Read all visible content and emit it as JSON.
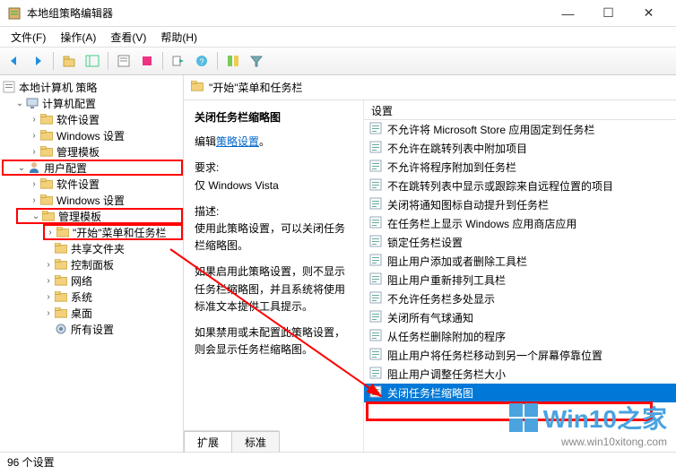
{
  "window": {
    "title": "本地组策略编辑器",
    "min": "—",
    "max": "☐",
    "close": "✕"
  },
  "menus": {
    "file": "文件(F)",
    "action": "操作(A)",
    "view": "查看(V)",
    "help": "帮助(H)"
  },
  "tree": {
    "root": "本地计算机 策略",
    "computer": "计算机配置",
    "c_software": "软件设置",
    "c_windows": "Windows 设置",
    "c_admin": "管理模板",
    "user": "用户配置",
    "u_software": "软件设置",
    "u_windows": "Windows 设置",
    "u_admin": "管理模板",
    "start_taskbar": "\"开始\"菜单和任务栏",
    "shared": "共享文件夹",
    "control": "控制面板",
    "network": "网络",
    "system": "系统",
    "desktop": "桌面",
    "all": "所有设置"
  },
  "pathbar": {
    "label": "\"开始\"菜单和任务栏"
  },
  "desc": {
    "title": "关闭任务栏缩略图",
    "edit_prefix": "编辑",
    "edit_link": "策略设置",
    "req_label": "要求:",
    "req_value": "仅 Windows Vista",
    "overview_label": "描述:",
    "overview_text": "使用此策略设置，可以关闭任务栏缩略图。",
    "enabled_text": "如果启用此策略设置，则不显示任务栏缩略图，并且系统将使用标准文本提供工具提示。",
    "disabled_text": "如果禁用或未配置此策略设置，则会显示任务栏缩略图。"
  },
  "list_header": "设置",
  "settings": [
    "不允许将 Microsoft Store 应用固定到任务栏",
    "不允许在跳转列表中附加项目",
    "不允许将程序附加到任务栏",
    "不在跳转列表中显示或跟踪来自远程位置的项目",
    "关闭将通知图标自动提升到任务栏",
    "在任务栏上显示 Windows 应用商店应用",
    "锁定任务栏设置",
    "阻止用户添加或者删除工具栏",
    "阻止用户重新排列工具栏",
    "不允许任务栏多处显示",
    "关闭所有气球通知",
    "从任务栏删除附加的程序",
    "阻止用户将任务栏移动到另一个屏幕停靠位置",
    "阻止用户调整任务栏大小",
    "关闭任务栏缩略图"
  ],
  "tabs": {
    "extended": "扩展",
    "standard": "标准"
  },
  "status": "96 个设置",
  "watermark": {
    "brand": "Win10之家",
    "url": "www.win10xitong.com"
  }
}
